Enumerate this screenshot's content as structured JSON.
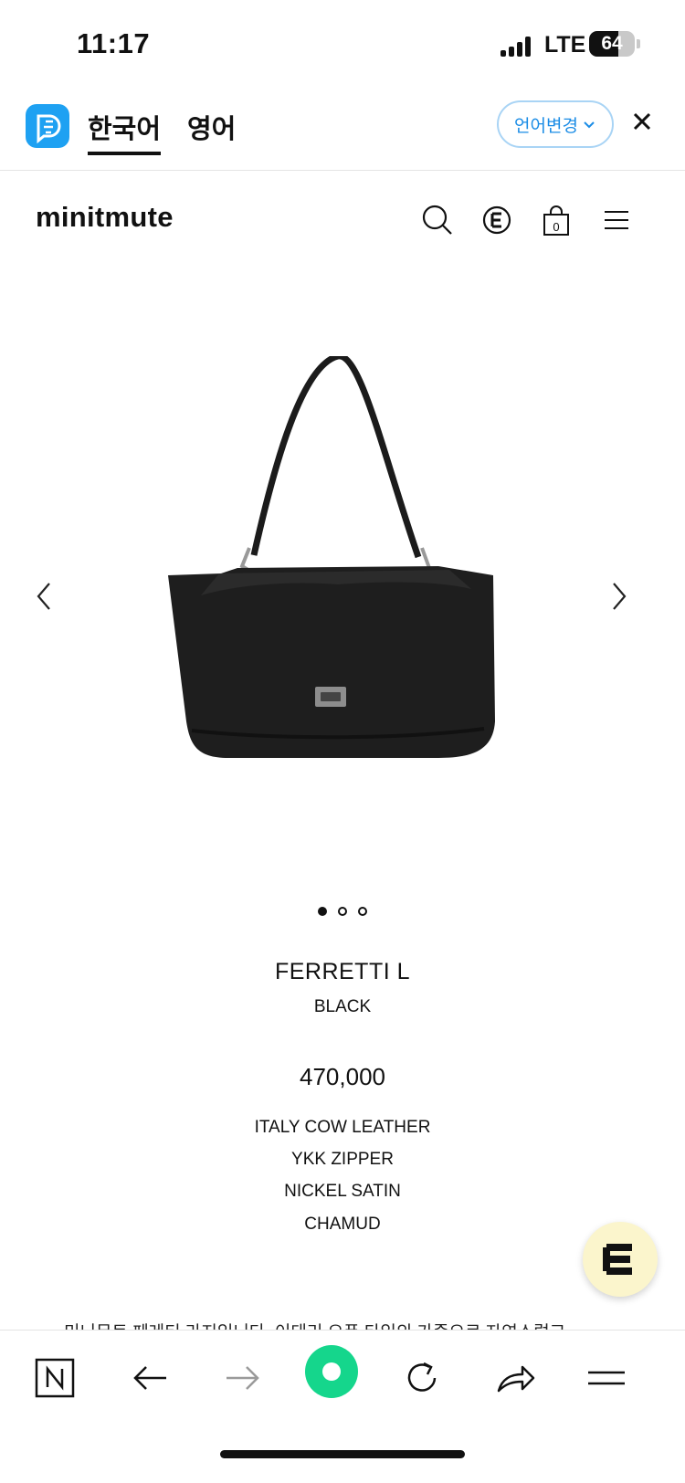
{
  "status_bar": {
    "time": "11:17",
    "network": "LTE",
    "battery": "64",
    "battery_level": 0.64
  },
  "translate_bar": {
    "languages": [
      "한국어",
      "영어"
    ],
    "change_language_label": "언어변경"
  },
  "site": {
    "logo": "minitmute",
    "cart_count": "0"
  },
  "gallery": {
    "slide_count": 3,
    "active_slide": 1
  },
  "product": {
    "name": "FERRETTI L",
    "color": "BLACK",
    "price": "470,000",
    "specs": [
      "ITALY COW LEATHER",
      "YKK ZIPPER",
      "NICKEL SATIN",
      "CHAMUD"
    ],
    "description": "미니뮤트 페레티 라지입니다. 이태리 오픈 타입의 가죽으로 자연스럽고"
  },
  "icons": {
    "translate_app": "papago-icon",
    "search": "search-icon",
    "membership": "membership-icon",
    "cart": "shopping-bag-icon",
    "menu": "hamburger-menu-icon",
    "browser_home": "naver-n-icon",
    "back": "back-arrow-icon",
    "forward": "forward-arrow-icon",
    "green_dot": "green-dot-icon",
    "reload": "reload-icon",
    "share": "share-icon",
    "tabs_menu": "menu-lines-icon",
    "chat": "chat-fab-icon"
  },
  "colors": {
    "accent_blue": "#1a8ce6",
    "green": "#15d68c",
    "fab_bg": "#fbf5cc"
  }
}
